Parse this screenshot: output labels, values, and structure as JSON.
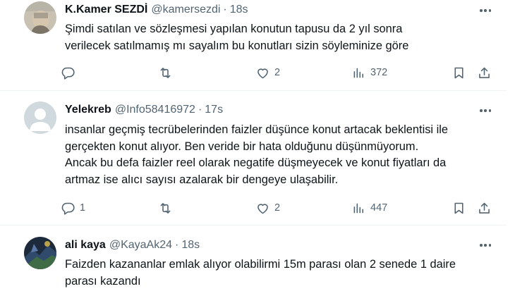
{
  "tweets": [
    {
      "name": "K.Kamer SEZDİ",
      "handle": "@kamersezdi",
      "separator": "·",
      "time": "18s",
      "lines": [
        "Şimdi satılan ve  sözleşmesi yapılan konutun tapusu  da  2 yıl sonra",
        "verilecek  satılmamış mı sayalım bu konutları sizin söyleminize göre"
      ],
      "replies": "",
      "reposts": "",
      "likes": "2",
      "views": "372",
      "avatar": "photo"
    },
    {
      "name": "Yelekreb",
      "handle": "@Info58416972",
      "separator": "·",
      "time": "17s",
      "lines": [
        "insanlar geçmiş tecrübelerinden faizler düşünce konut artacak beklentisi ile",
        "gerçekten konut alıyor. Ben veride bir hata olduğunu düşünmüyorum.",
        "Ancak bu defa faizler reel olarak negatife düşmeyecek ve konut fiyatları da",
        "artmaz ise alıcı sayısı azalarak bir dengeye ulaşabilir."
      ],
      "replies": "1",
      "reposts": "",
      "likes": "2",
      "views": "447",
      "avatar": "default-profile"
    },
    {
      "name": "ali kaya",
      "handle": "@KayaAk24",
      "separator": "·",
      "time": "18s",
      "lines": [
        "Faizden kazananlar emlak alıyor olabilirmi 15m parası olan 2 senede 1 daire",
        "parası kazandı"
      ],
      "avatar": "photo"
    }
  ],
  "icons": {
    "reply": "reply-icon",
    "repost": "repost-icon",
    "like": "heart-icon",
    "views": "views-icon",
    "bookmark": "bookmark-icon",
    "share": "share-icon",
    "more": "more-icon"
  },
  "colors": {
    "text": "#0f1419",
    "secondary": "#536471",
    "divider": "#eff3f4"
  }
}
